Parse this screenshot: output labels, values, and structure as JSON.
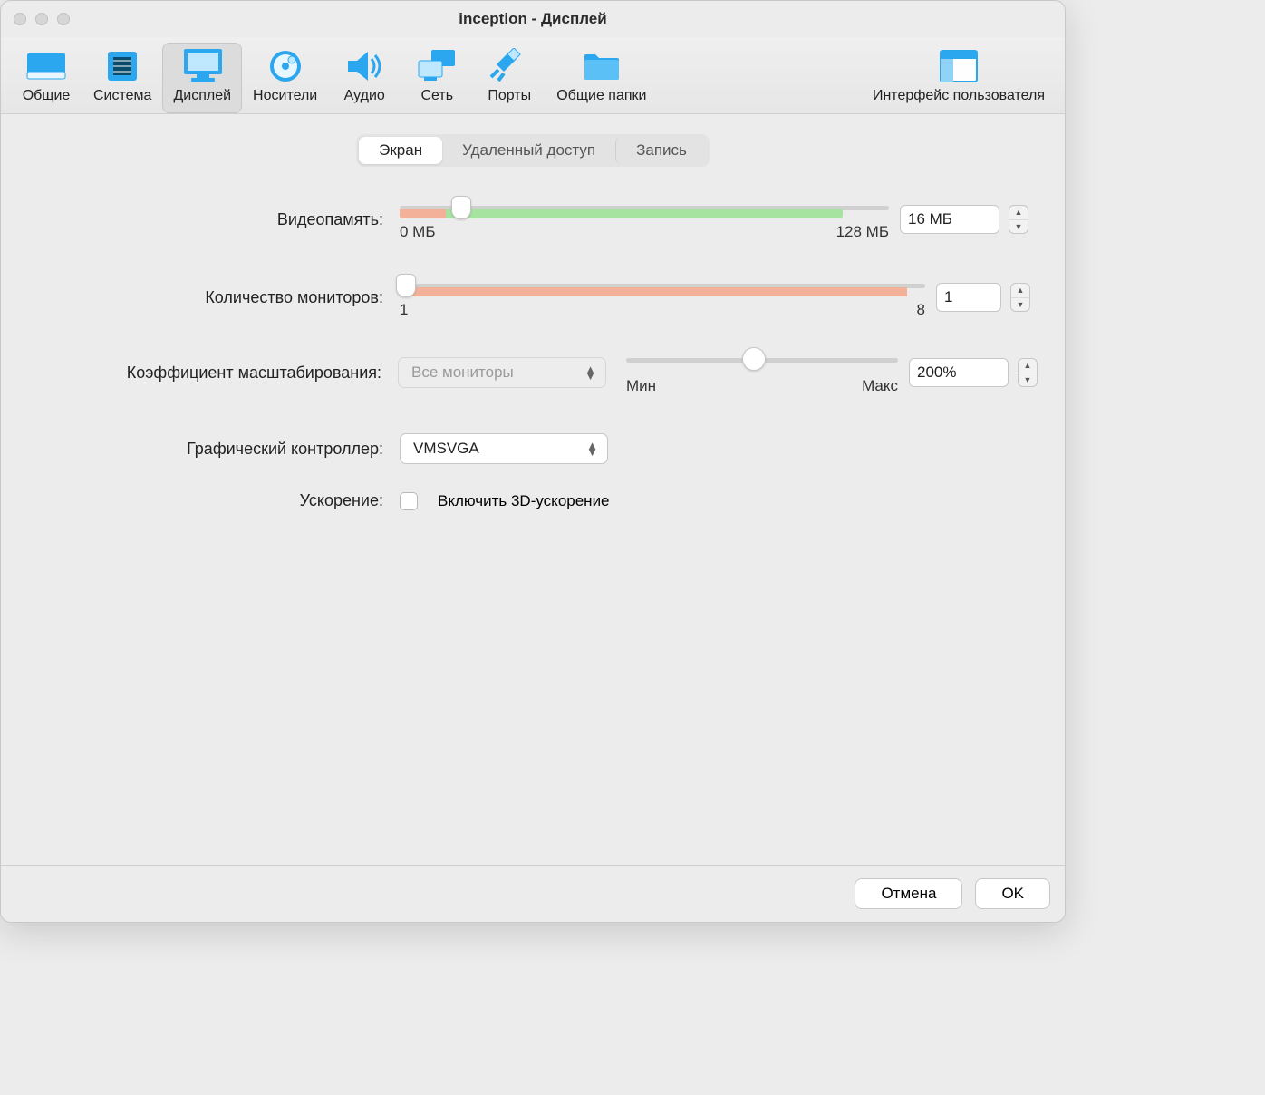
{
  "window": {
    "title": "inception - Дисплей"
  },
  "toolbar": {
    "items": [
      {
        "label": "Общие",
        "selected": false,
        "icon": "general"
      },
      {
        "label": "Система",
        "selected": false,
        "icon": "system"
      },
      {
        "label": "Дисплей",
        "selected": true,
        "icon": "display"
      },
      {
        "label": "Носители",
        "selected": false,
        "icon": "storage"
      },
      {
        "label": "Аудио",
        "selected": false,
        "icon": "audio"
      },
      {
        "label": "Сеть",
        "selected": false,
        "icon": "network"
      },
      {
        "label": "Порты",
        "selected": false,
        "icon": "ports"
      },
      {
        "label": "Общие папки",
        "selected": false,
        "icon": "shared"
      },
      {
        "label": "Интерфейс пользователя",
        "selected": false,
        "icon": "ui"
      }
    ]
  },
  "tabs": [
    {
      "label": "Экран",
      "selected": true
    },
    {
      "label": "Удаленный доступ",
      "selected": false
    },
    {
      "label": "Запись",
      "selected": false
    }
  ],
  "form": {
    "video_memory": {
      "label": "Видеопамять:",
      "min_label": "0 МБ",
      "max_label": "128 МБ",
      "value": "16 МБ",
      "min": 0,
      "max": 128,
      "current": 16,
      "warn_end": 12,
      "ok_end": 116
    },
    "monitors": {
      "label": "Количество мониторов:",
      "min_label": "1",
      "max_label": "8",
      "value": "1",
      "min": 1,
      "max": 8,
      "current": 1
    },
    "scale": {
      "label": "Коэффициент масштабирования:",
      "dropdown": "Все мониторы",
      "value": "200%",
      "min_label": "Мин",
      "max_label": "Макс",
      "slider_pos": 0.47
    },
    "controller": {
      "label": "Графический контроллер:",
      "value": "VMSVGA"
    },
    "accel": {
      "label": "Ускорение:",
      "checkbox_label": "Включить 3D-ускорение",
      "checked": false
    }
  },
  "footer": {
    "cancel": "Отмена",
    "ok": "OK"
  }
}
